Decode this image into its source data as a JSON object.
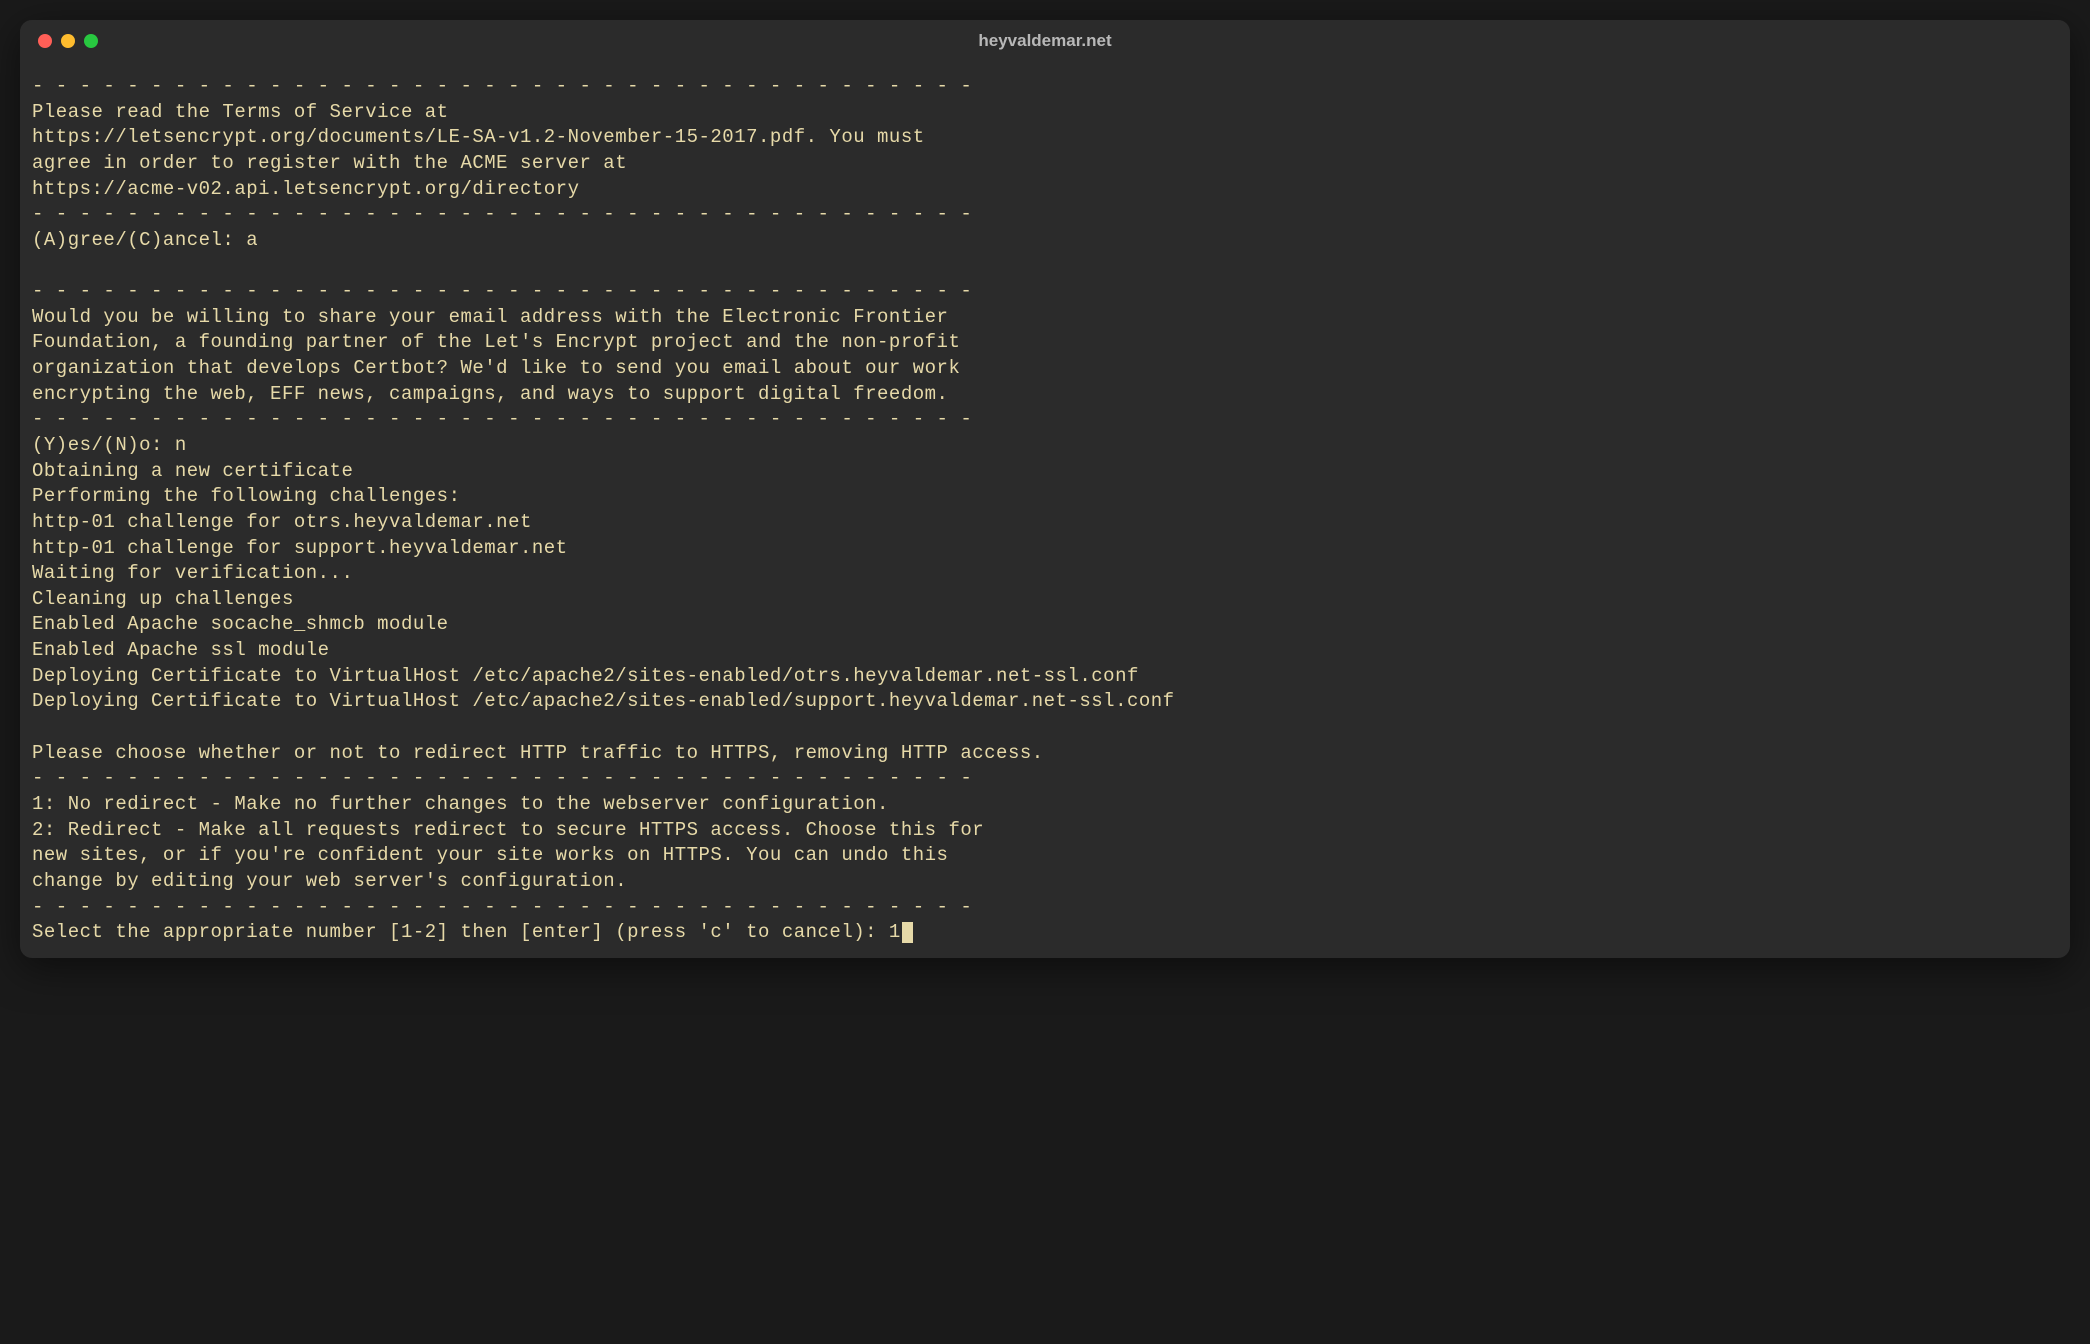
{
  "window": {
    "title": "heyvaldemar.net"
  },
  "terminal": {
    "lines": [
      "- - - - - - - - - - - - - - - - - - - - - - - - - - - - - - - - - - - - - - - -",
      "Please read the Terms of Service at",
      "https://letsencrypt.org/documents/LE-SA-v1.2-November-15-2017.pdf. You must",
      "agree in order to register with the ACME server at",
      "https://acme-v02.api.letsencrypt.org/directory",
      "- - - - - - - - - - - - - - - - - - - - - - - - - - - - - - - - - - - - - - - -",
      "(A)gree/(C)ancel: a",
      "",
      "- - - - - - - - - - - - - - - - - - - - - - - - - - - - - - - - - - - - - - - -",
      "Would you be willing to share your email address with the Electronic Frontier",
      "Foundation, a founding partner of the Let's Encrypt project and the non-profit",
      "organization that develops Certbot? We'd like to send you email about our work",
      "encrypting the web, EFF news, campaigns, and ways to support digital freedom.",
      "- - - - - - - - - - - - - - - - - - - - - - - - - - - - - - - - - - - - - - - -",
      "(Y)es/(N)o: n",
      "Obtaining a new certificate",
      "Performing the following challenges:",
      "http-01 challenge for otrs.heyvaldemar.net",
      "http-01 challenge for support.heyvaldemar.net",
      "Waiting for verification...",
      "Cleaning up challenges",
      "Enabled Apache socache_shmcb module",
      "Enabled Apache ssl module",
      "Deploying Certificate to VirtualHost /etc/apache2/sites-enabled/otrs.heyvaldemar.net-ssl.conf",
      "Deploying Certificate to VirtualHost /etc/apache2/sites-enabled/support.heyvaldemar.net-ssl.conf",
      "",
      "Please choose whether or not to redirect HTTP traffic to HTTPS, removing HTTP access.",
      "- - - - - - - - - - - - - - - - - - - - - - - - - - - - - - - - - - - - - - - -",
      "1: No redirect - Make no further changes to the webserver configuration.",
      "2: Redirect - Make all requests redirect to secure HTTPS access. Choose this for",
      "new sites, or if you're confident your site works on HTTPS. You can undo this",
      "change by editing your web server's configuration.",
      "- - - - - - - - - - - - - - - - - - - - - - - - - - - - - - - - - - - - - - - -"
    ],
    "prompt_line": "Select the appropriate number [1-2] then [enter] (press 'c' to cancel): 1"
  }
}
